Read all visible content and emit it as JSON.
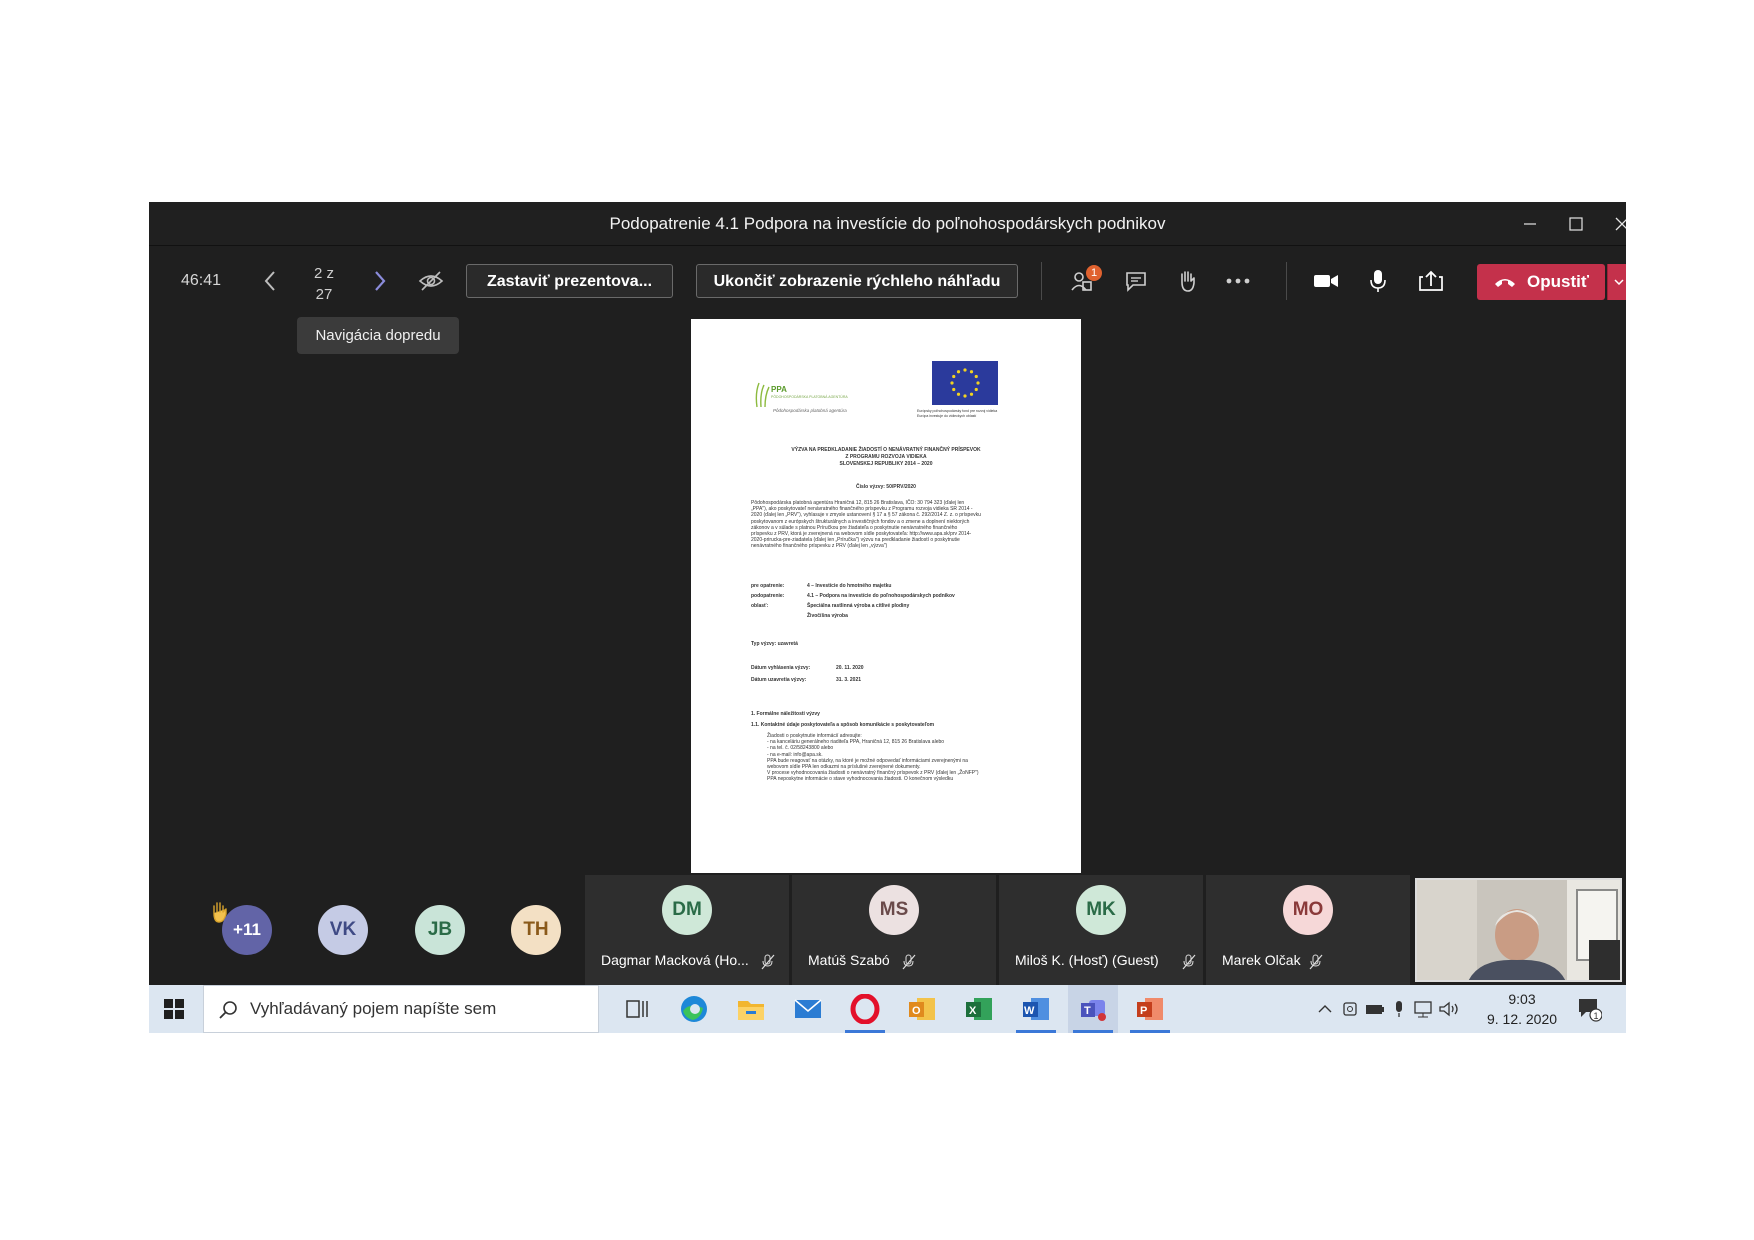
{
  "window": {
    "title": "Podopatrenie 4.1 Podpora na investície do poľnohospodárskych podnikov"
  },
  "toolbar": {
    "timer": "46:41",
    "page_current": "2 z",
    "page_total": "27",
    "stop_presenting": "Zastaviť prezentova...",
    "end_preview": "Ukončiť zobrazenie rýchleho náhľadu",
    "participants_badge": "1",
    "leave_label": "Opustiť"
  },
  "tooltip": {
    "text": "Navigácia dopredu"
  },
  "document": {
    "logo_ppa": "PPA",
    "logo_ppa_sub": "PÔDOHOSPODÁRSKA PLATOBNÁ AGENTÚRA",
    "logo_ppa_caption": "Pôdohospodárska platobná agentúra",
    "eu_caption_1": "Európsky poľnohospodársky fond pre rozvoj vidieka",
    "eu_caption_2": "Európa investuje do vidieckych oblastí",
    "heading_1": "VÝZVA NA PREDKLADANIE ŽIADOSTÍ O NENÁVRATNÝ FINANČNÝ PRÍSPEVOK",
    "heading_2": "Z PROGRAMU ROZVOJA VIDIEKA",
    "heading_3": "SLOVENSKEJ REPUBLIKY 2014 – 2020",
    "call_number": "Číslo výzvy: 50/PRV/2020",
    "intro": [
      "Pôdohospodárska platobná agentúra Hraničná 12, 815 26 Bratislava, IČO: 30 794 323 (ďalej len",
      "„PPA\"), ako poskytovateľ nenávratného finančného príspevku z Programu rozvoja vidieka SR 2014 -",
      "2020 (ďalej len „PRV\"), vyhlasuje v zmysle ustanovení § 17 a § 57 zákona č. 292/2014 Z. z. o príspevku",
      "poskytovanom z európskych štrukturálnych a investičných fondov a o zmene a doplnení niektorých",
      "zákonov a v súlade s platnou Príručkou pre žiadateľa o poskytnutie nenávratného finančného",
      "príspevku z PRV, ktorá je zverejnená na webovom sídle poskytovateľa: http://www.apa.sk/prv 2014-",
      "2020-prirucka-pre-ziadatela (ďalej len „Príručka\") výzvu na predkladanie žiadostí o poskytnutie",
      "nenávratného finančného príspevku z PRV (ďalej len „výzva\")"
    ],
    "rows": [
      {
        "label": "pre opatrenie:",
        "value": "4 – Investície do hmotného majetku"
      },
      {
        "label": "podopatrenie:",
        "value": "4.1 – Podpora na investície do poľnohospodárskych podnikov"
      },
      {
        "label": "oblasť:",
        "value": "Špeciálna rastlinná výroba a citlivé plodiny"
      },
      {
        "label": "",
        "value": "Živočíšna výroba"
      }
    ],
    "call_type": "Typ výzvy: uzavretá",
    "date_announce_label": "Dátum vyhlásenia výzvy:",
    "date_announce": "20. 11. 2020",
    "date_close_label": "Dátum uzavretia výzvy:",
    "date_close": "31. 3. 2021",
    "sec_1": "1.     Formálne náležitosti výzvy",
    "sec_11": "1.1.   Kontaktné údaje poskytovateľa a spôsob komunikácie s poskytovateľom",
    "contacts": [
      "Žiadosti o poskytnutie informácií adresujte:",
      "-    na kanceláriu generálneho riaditeľa PPA, Hraničná 12, 815 26 Bratislava alebo",
      "-    na tel. č. 02/58243800 alebo",
      "-    na e-mail: info@apa.sk.",
      "PPA bude reagovať na otázky, na ktoré je možné odpovedať informáciami zverejnenými na",
      "webovom sídle PPA len odkazmi na príslušné zverejnené dokumenty.",
      "V procese vyhodnocovania žiadosti o nenávratný finančný príspevok z PRV (ďalej len „ŽoNFP\")",
      "PPA neposkytne informácie o stave vyhodnocovania žiadosti. O konečnom výsledku"
    ]
  },
  "participants": {
    "overflow": {
      "initials": "+11",
      "color": "#6264a7"
    },
    "circles": [
      {
        "initials": "VK",
        "color": "#c5cbe5"
      },
      {
        "initials": "JB",
        "color": "#c9e4d8"
      },
      {
        "initials": "TH",
        "color": "#f3e0c4"
      }
    ],
    "tiles": [
      {
        "initials": "DM",
        "name": "Dagmar Macková (Ho...",
        "color": "#cfe8d8",
        "text_color": "#2a6b47"
      },
      {
        "initials": "MS",
        "name": "Matúš Szabó",
        "color": "#ece1e1",
        "text_color": "#6a4a4a"
      },
      {
        "initials": "MK",
        "name": "Miloš K. (Hosť) (Guest)",
        "color": "#cfe8d8",
        "text_color": "#2a6b47"
      },
      {
        "initials": "MO",
        "name": "Marek Olčak",
        "color": "#f6d8d8",
        "text_color": "#8a3a3a"
      }
    ]
  },
  "taskbar": {
    "search_placeholder": "Vyhľadávaný pojem napíšte sem",
    "time": "9:03",
    "date": "9. 12. 2020",
    "notif_count": "1"
  },
  "colors": {
    "accent": "#6264a7",
    "leave": "#c4314b",
    "badge": "#e0622f"
  }
}
